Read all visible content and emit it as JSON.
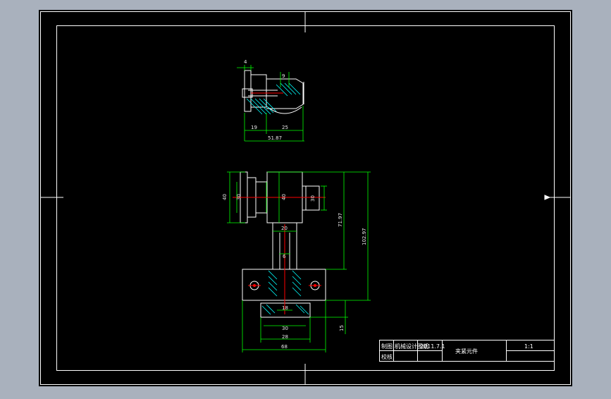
{
  "colors": {
    "background": "#a9b1bd",
    "canvas": "#000000",
    "part_outline": "#ffffff",
    "dimension": "#00ff00",
    "center_line": "#ff0000",
    "hatch": "#00ffff"
  },
  "top_view": {
    "dims": {
      "d_top": "4",
      "d_ball": "9",
      "d_left": "19",
      "d_right": "25",
      "d_total": "51.87"
    }
  },
  "front_view": {
    "dims": {
      "d_40_left": "40",
      "d_30_left": "30",
      "d_40_mid": "40",
      "d_30_right": "30",
      "d_7197": "71.97",
      "d_10297": "102.97",
      "d_20": "20",
      "d_6": "6",
      "d_18": "18",
      "d_30_bot": "30",
      "d_28": "28",
      "d_68": "68",
      "d_15": "15"
    }
  },
  "title_block": {
    "designer_label": "制图",
    "designer_value": "机械设计图纸",
    "date": "2011.7.1",
    "checker_label": "校核",
    "part_name": "夹紧元件",
    "scale": "1:1"
  }
}
